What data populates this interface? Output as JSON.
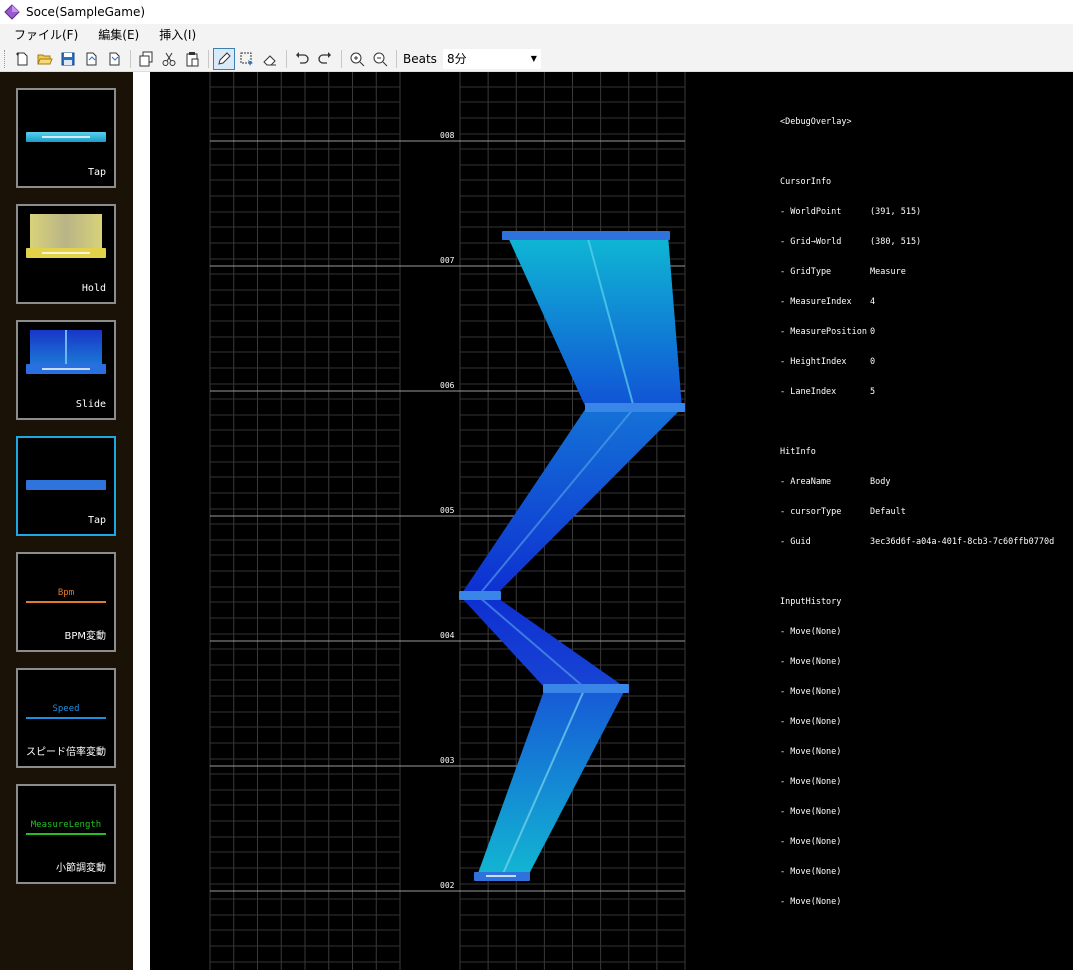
{
  "window": {
    "title": "Soce(SampleGame)"
  },
  "menu": {
    "items": [
      "ファイル(F)",
      "編集(E)",
      "挿入(I)"
    ]
  },
  "toolbar": {
    "division_label": "Beats",
    "division_value": "8分"
  },
  "palette": {
    "items": [
      {
        "label": "Tap",
        "type": "tap-cyan"
      },
      {
        "label": "Hold",
        "type": "hold"
      },
      {
        "label": "Slide",
        "type": "slide"
      },
      {
        "label": "Tap",
        "type": "tap-blue",
        "selected": true
      },
      {
        "label": "BPM変動",
        "line_label": "Bpm",
        "color": "#e07b2a"
      },
      {
        "label": "スピード倍率変動",
        "line_label": "Speed",
        "color": "#1d8fe0"
      },
      {
        "label": "小節調変動",
        "line_label": "MeasureLength",
        "color": "#22c022"
      }
    ]
  },
  "editor": {
    "measure_labels": [
      "002",
      "003",
      "004",
      "005",
      "006",
      "007",
      "008"
    ]
  },
  "debug": {
    "title": "<DebugOverlay>",
    "cursor_header": "CursorInfo",
    "cursor": [
      {
        "key": "- WorldPoint",
        "value": "(391, 515)"
      },
      {
        "key": "- Grid→World",
        "value": "(380, 515)"
      },
      {
        "key": "- GridType",
        "value": "Measure"
      },
      {
        "key": "- MeasureIndex",
        "value": "4"
      },
      {
        "key": "- MeasurePosition",
        "value": "0"
      },
      {
        "key": "- HeightIndex",
        "value": "0"
      },
      {
        "key": "- LaneIndex",
        "value": "5"
      }
    ],
    "hit_header": "HitInfo",
    "hit": [
      {
        "key": "- AreaName",
        "value": "Body"
      },
      {
        "key": "- cursorType",
        "value": "Default"
      },
      {
        "key": "- Guid",
        "value": "3ec36d6f-a04a-401f-8cb3-7c60ffb0770d"
      }
    ],
    "input_header": "InputHistory",
    "input": [
      "- Move(None)",
      "- Move(None)",
      "- Move(None)",
      "- Move(None)",
      "- Move(None)",
      "- Move(None)",
      "- Move(None)",
      "- Move(None)",
      "- Move(None)",
      "- Move(None)"
    ]
  }
}
